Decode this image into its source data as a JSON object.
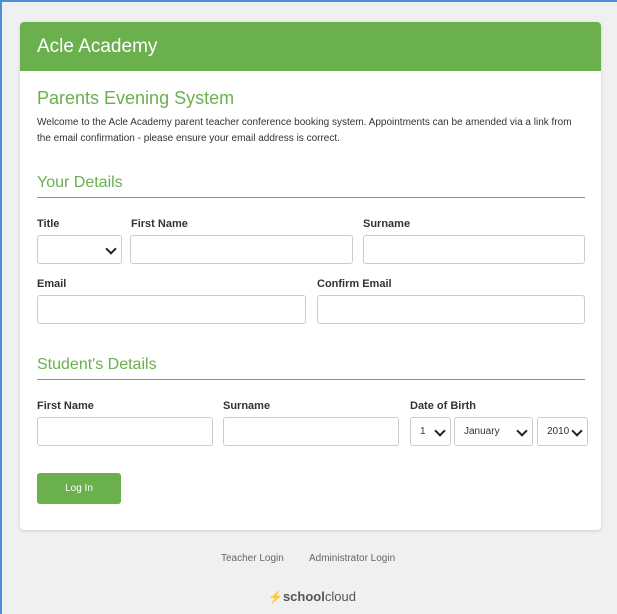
{
  "app": {
    "school_name": "Acle Academy",
    "system_title": "Parents Evening System",
    "intro_text": "Welcome to the Acle Academy parent teacher conference booking system. Appointments can be amended via a link from the email confirmation - please ensure your email address is correct."
  },
  "your_details": {
    "heading": "Your Details",
    "title_label": "Title",
    "title_value": "",
    "first_name_label": "First Name",
    "surname_label": "Surname",
    "email_label": "Email",
    "confirm_email_label": "Confirm Email"
  },
  "student_details": {
    "heading": "Student's Details",
    "first_name_label": "First Name",
    "surname_label": "Surname",
    "dob_label": "Date of Birth",
    "dob_day": "1",
    "dob_month": "January",
    "dob_year": "2010"
  },
  "actions": {
    "login_label": "Log In"
  },
  "footer": {
    "teacher_login": "Teacher Login",
    "admin_login": "Administrator Login",
    "logo_bold": "school",
    "logo_light": "cloud"
  },
  "colors": {
    "accent": "#6ab04c",
    "frame": "#4a90d9"
  }
}
